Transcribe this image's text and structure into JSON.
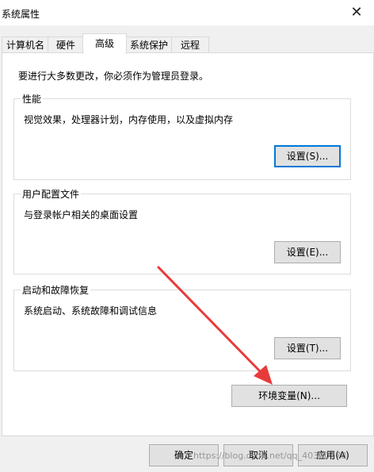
{
  "window": {
    "title": "系统属性",
    "close_icon": "close-icon"
  },
  "tabs": [
    {
      "label": "计算机名"
    },
    {
      "label": "硬件"
    },
    {
      "label": "高级",
      "active": true
    },
    {
      "label": "系统保护"
    },
    {
      "label": "远程"
    }
  ],
  "notice": "要进行大多数更改，你必须作为管理员登录。",
  "groups": {
    "performance": {
      "title": "性能",
      "description": "视觉效果，处理器计划，内存使用，以及虚拟内存",
      "button": "设置(S)..."
    },
    "user_profiles": {
      "title": "用户配置文件",
      "description": "与登录帐户相关的桌面设置",
      "button": "设置(E)..."
    },
    "startup_recovery": {
      "title": "启动和故障恢复",
      "description": "系统启动、系统故障和调试信息",
      "button": "设置(T)..."
    }
  },
  "env_button": "环境变量(N)...",
  "footer": {
    "ok": "确定",
    "cancel": "取消",
    "apply": "应用(A)"
  },
  "annotation": {
    "arrow_color": "#e83a3a"
  },
  "watermark": "https://blog.csdn.net/qq_40300778"
}
